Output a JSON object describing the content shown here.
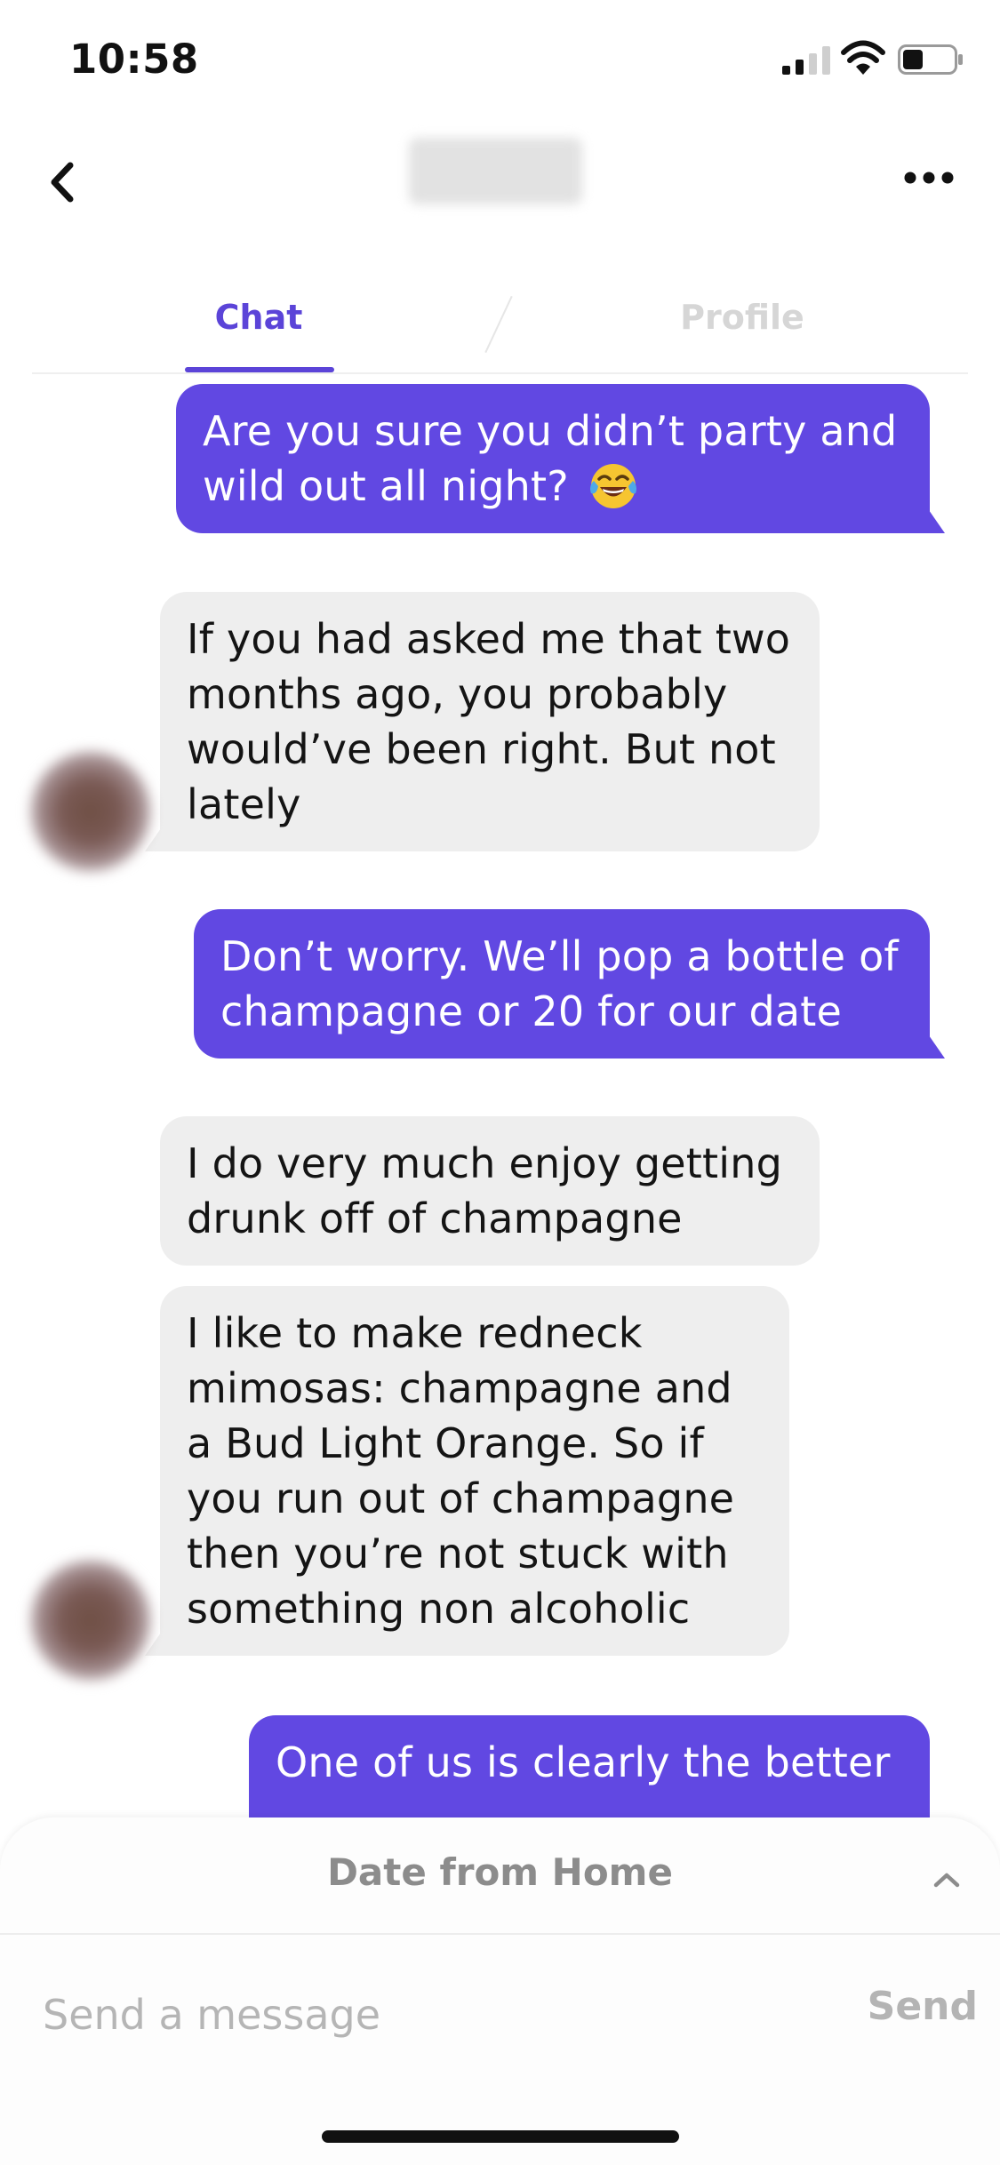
{
  "status_bar": {
    "time": "10:58"
  },
  "header": {
    "back_icon": "chevron-left-icon",
    "more_icon": "ellipsis-icon"
  },
  "tabs": [
    {
      "label": "Chat",
      "active": true
    },
    {
      "label": "Profile",
      "active": false
    }
  ],
  "messages": [
    {
      "direction": "outgoing",
      "text": "Are you sure you didn’t party and wild out all night?",
      "emoji": "face-with-tears-of-joy"
    },
    {
      "direction": "incoming",
      "text": "If you had asked me that two months ago, you probably would’ve been right. But not lately"
    },
    {
      "direction": "outgoing",
      "text": "Don’t worry. We’ll pop a bottle of champagne or 20 for our date"
    },
    {
      "direction": "incoming",
      "text": "I do very much enjoy getting drunk off of champagne"
    },
    {
      "direction": "incoming",
      "text": "I like to make redneck mimosas: champagne and a Bud Light Orange. So if you run out of champagne then you’re not stuck with something non alcoholic"
    },
    {
      "direction": "outgoing",
      "text": "One of us is clearly the better"
    }
  ],
  "bottom_sheet": {
    "title": "Date from Home",
    "input_placeholder": "Send a message",
    "send_label": "Send"
  },
  "colors": {
    "accent": "#5b44d8",
    "outgoing_bubble": "#6148e2",
    "incoming_bubble": "#eeeeee"
  }
}
